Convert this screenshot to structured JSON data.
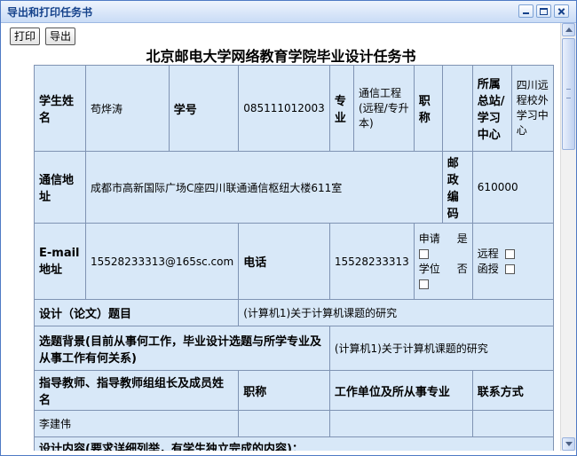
{
  "window": {
    "title": "导出和打印任务书"
  },
  "toolbar": {
    "print_label": "打印",
    "export_label": "导出"
  },
  "document": {
    "title": "北京邮电大学网络教育学院毕业设计任务书",
    "row1": {
      "student_name_label": "学生姓名",
      "student_name": "苟烨涛",
      "student_id_label": "学号",
      "student_id": "085111012003",
      "major_label": "专业",
      "major": "通信工程(远程/专升本)",
      "title_label": "职称",
      "title_value": "",
      "station_label": "所属总站/学习中心",
      "station": "四川远程校外学习中心"
    },
    "row2": {
      "address_label": "通信地址",
      "address": "成都市高新国际广场C座四川联通通信枢纽大楼611室",
      "postcode_label": "邮政编码",
      "postcode": "610000"
    },
    "row3": {
      "email_label": "E-mail地址",
      "email": "15528233313@165sc.com",
      "phone_label": "电话",
      "phone": "15528233313",
      "degree_apply": "申请",
      "degree": "学位",
      "yes": "是",
      "no": "否",
      "remote": "远程",
      "correspondence": "函授"
    },
    "row4": {
      "topic_label": "设计（论文）题目",
      "topic": "(计算机1)关于计算机课题的研究"
    },
    "row5": {
      "background_label": "选题背景(目前从事何工作，毕业设计选题与所学专业及从事工作有何关系)",
      "background": "(计算机1)关于计算机课题的研究"
    },
    "row6": {
      "advisor_label": "指导教师、指导教师组组长及成员姓名",
      "advisor_title_label": "职称",
      "work_unit_label": "工作单位及所从事专业",
      "contact_label": "联系方式"
    },
    "row7": {
      "advisor_name": "李建伟"
    },
    "row8": {
      "design_content_label": "设计内容(要求详细列举，有学生独立完成的内容)："
    }
  }
}
